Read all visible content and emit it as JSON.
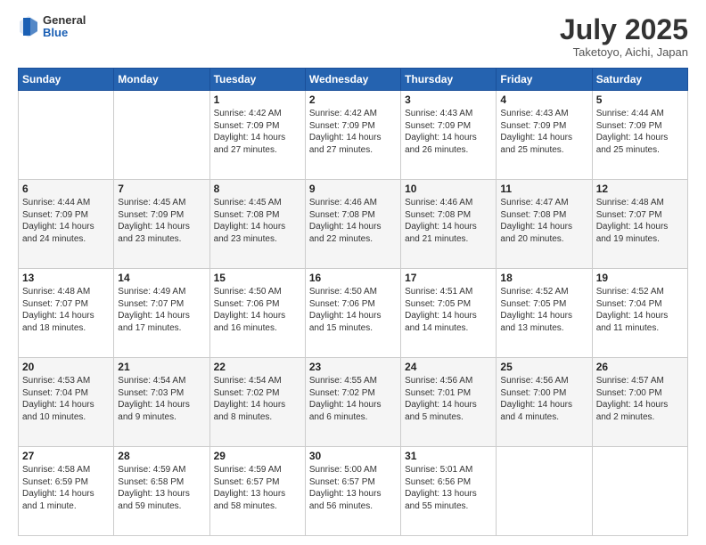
{
  "header": {
    "logo": {
      "general": "General",
      "blue": "Blue"
    },
    "month": "July 2025",
    "location": "Taketoyo, Aichi, Japan"
  },
  "weekdays": [
    "Sunday",
    "Monday",
    "Tuesday",
    "Wednesday",
    "Thursday",
    "Friday",
    "Saturday"
  ],
  "weeks": [
    [
      {
        "day": "",
        "sunrise": "",
        "sunset": "",
        "daylight": ""
      },
      {
        "day": "",
        "sunrise": "",
        "sunset": "",
        "daylight": ""
      },
      {
        "day": "1",
        "sunrise": "Sunrise: 4:42 AM",
        "sunset": "Sunset: 7:09 PM",
        "daylight": "Daylight: 14 hours and 27 minutes."
      },
      {
        "day": "2",
        "sunrise": "Sunrise: 4:42 AM",
        "sunset": "Sunset: 7:09 PM",
        "daylight": "Daylight: 14 hours and 27 minutes."
      },
      {
        "day": "3",
        "sunrise": "Sunrise: 4:43 AM",
        "sunset": "Sunset: 7:09 PM",
        "daylight": "Daylight: 14 hours and 26 minutes."
      },
      {
        "day": "4",
        "sunrise": "Sunrise: 4:43 AM",
        "sunset": "Sunset: 7:09 PM",
        "daylight": "Daylight: 14 hours and 25 minutes."
      },
      {
        "day": "5",
        "sunrise": "Sunrise: 4:44 AM",
        "sunset": "Sunset: 7:09 PM",
        "daylight": "Daylight: 14 hours and 25 minutes."
      }
    ],
    [
      {
        "day": "6",
        "sunrise": "Sunrise: 4:44 AM",
        "sunset": "Sunset: 7:09 PM",
        "daylight": "Daylight: 14 hours and 24 minutes."
      },
      {
        "day": "7",
        "sunrise": "Sunrise: 4:45 AM",
        "sunset": "Sunset: 7:09 PM",
        "daylight": "Daylight: 14 hours and 23 minutes."
      },
      {
        "day": "8",
        "sunrise": "Sunrise: 4:45 AM",
        "sunset": "Sunset: 7:08 PM",
        "daylight": "Daylight: 14 hours and 23 minutes."
      },
      {
        "day": "9",
        "sunrise": "Sunrise: 4:46 AM",
        "sunset": "Sunset: 7:08 PM",
        "daylight": "Daylight: 14 hours and 22 minutes."
      },
      {
        "day": "10",
        "sunrise": "Sunrise: 4:46 AM",
        "sunset": "Sunset: 7:08 PM",
        "daylight": "Daylight: 14 hours and 21 minutes."
      },
      {
        "day": "11",
        "sunrise": "Sunrise: 4:47 AM",
        "sunset": "Sunset: 7:08 PM",
        "daylight": "Daylight: 14 hours and 20 minutes."
      },
      {
        "day": "12",
        "sunrise": "Sunrise: 4:48 AM",
        "sunset": "Sunset: 7:07 PM",
        "daylight": "Daylight: 14 hours and 19 minutes."
      }
    ],
    [
      {
        "day": "13",
        "sunrise": "Sunrise: 4:48 AM",
        "sunset": "Sunset: 7:07 PM",
        "daylight": "Daylight: 14 hours and 18 minutes."
      },
      {
        "day": "14",
        "sunrise": "Sunrise: 4:49 AM",
        "sunset": "Sunset: 7:07 PM",
        "daylight": "Daylight: 14 hours and 17 minutes."
      },
      {
        "day": "15",
        "sunrise": "Sunrise: 4:50 AM",
        "sunset": "Sunset: 7:06 PM",
        "daylight": "Daylight: 14 hours and 16 minutes."
      },
      {
        "day": "16",
        "sunrise": "Sunrise: 4:50 AM",
        "sunset": "Sunset: 7:06 PM",
        "daylight": "Daylight: 14 hours and 15 minutes."
      },
      {
        "day": "17",
        "sunrise": "Sunrise: 4:51 AM",
        "sunset": "Sunset: 7:05 PM",
        "daylight": "Daylight: 14 hours and 14 minutes."
      },
      {
        "day": "18",
        "sunrise": "Sunrise: 4:52 AM",
        "sunset": "Sunset: 7:05 PM",
        "daylight": "Daylight: 14 hours and 13 minutes."
      },
      {
        "day": "19",
        "sunrise": "Sunrise: 4:52 AM",
        "sunset": "Sunset: 7:04 PM",
        "daylight": "Daylight: 14 hours and 11 minutes."
      }
    ],
    [
      {
        "day": "20",
        "sunrise": "Sunrise: 4:53 AM",
        "sunset": "Sunset: 7:04 PM",
        "daylight": "Daylight: 14 hours and 10 minutes."
      },
      {
        "day": "21",
        "sunrise": "Sunrise: 4:54 AM",
        "sunset": "Sunset: 7:03 PM",
        "daylight": "Daylight: 14 hours and 9 minutes."
      },
      {
        "day": "22",
        "sunrise": "Sunrise: 4:54 AM",
        "sunset": "Sunset: 7:02 PM",
        "daylight": "Daylight: 14 hours and 8 minutes."
      },
      {
        "day": "23",
        "sunrise": "Sunrise: 4:55 AM",
        "sunset": "Sunset: 7:02 PM",
        "daylight": "Daylight: 14 hours and 6 minutes."
      },
      {
        "day": "24",
        "sunrise": "Sunrise: 4:56 AM",
        "sunset": "Sunset: 7:01 PM",
        "daylight": "Daylight: 14 hours and 5 minutes."
      },
      {
        "day": "25",
        "sunrise": "Sunrise: 4:56 AM",
        "sunset": "Sunset: 7:00 PM",
        "daylight": "Daylight: 14 hours and 4 minutes."
      },
      {
        "day": "26",
        "sunrise": "Sunrise: 4:57 AM",
        "sunset": "Sunset: 7:00 PM",
        "daylight": "Daylight: 14 hours and 2 minutes."
      }
    ],
    [
      {
        "day": "27",
        "sunrise": "Sunrise: 4:58 AM",
        "sunset": "Sunset: 6:59 PM",
        "daylight": "Daylight: 14 hours and 1 minute."
      },
      {
        "day": "28",
        "sunrise": "Sunrise: 4:59 AM",
        "sunset": "Sunset: 6:58 PM",
        "daylight": "Daylight: 13 hours and 59 minutes."
      },
      {
        "day": "29",
        "sunrise": "Sunrise: 4:59 AM",
        "sunset": "Sunset: 6:57 PM",
        "daylight": "Daylight: 13 hours and 58 minutes."
      },
      {
        "day": "30",
        "sunrise": "Sunrise: 5:00 AM",
        "sunset": "Sunset: 6:57 PM",
        "daylight": "Daylight: 13 hours and 56 minutes."
      },
      {
        "day": "31",
        "sunrise": "Sunrise: 5:01 AM",
        "sunset": "Sunset: 6:56 PM",
        "daylight": "Daylight: 13 hours and 55 minutes."
      },
      {
        "day": "",
        "sunrise": "",
        "sunset": "",
        "daylight": ""
      },
      {
        "day": "",
        "sunrise": "",
        "sunset": "",
        "daylight": ""
      }
    ]
  ]
}
